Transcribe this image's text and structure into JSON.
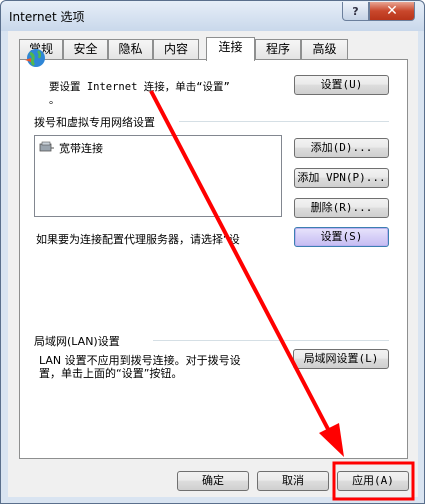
{
  "window": {
    "title": "Internet 选项",
    "help_label": "?",
    "close_label": "✕"
  },
  "tabs": [
    {
      "label": "常规"
    },
    {
      "label": "安全"
    },
    {
      "label": "隐私"
    },
    {
      "label": "内容"
    },
    {
      "label": "连接"
    },
    {
      "label": "程序"
    },
    {
      "label": "高级"
    }
  ],
  "active_tab": "连接",
  "setup": {
    "text_line1": "要设置 Internet 连接，单击“设置”",
    "text_line2": "。",
    "button_label": "设置(U)"
  },
  "dialup": {
    "group_label": "拨号和虚拟专用网络设置",
    "items": [
      {
        "label": "宽带连接"
      }
    ],
    "add_label": "添加(D)...",
    "add_vpn_label": "添加 VPN(P)...",
    "remove_label": "删除(R)...",
    "proxy_text": "如果要为连接配置代理服务器，请选择“设",
    "settings_label": "设置(S)"
  },
  "lan": {
    "group_label": "局域网(LAN)设置",
    "desc_line1": "LAN 设置不应用到拨号连接。对于拨号设",
    "desc_line2": "置，单击上面的“设置”按钮。",
    "button_label": "局域网设置(L)"
  },
  "footer": {
    "ok_label": "确定",
    "cancel_label": "取消",
    "apply_label": "应用(A)"
  },
  "colors": {
    "annotation_red": "#ff0000",
    "focus_button": "#d6cff7"
  }
}
